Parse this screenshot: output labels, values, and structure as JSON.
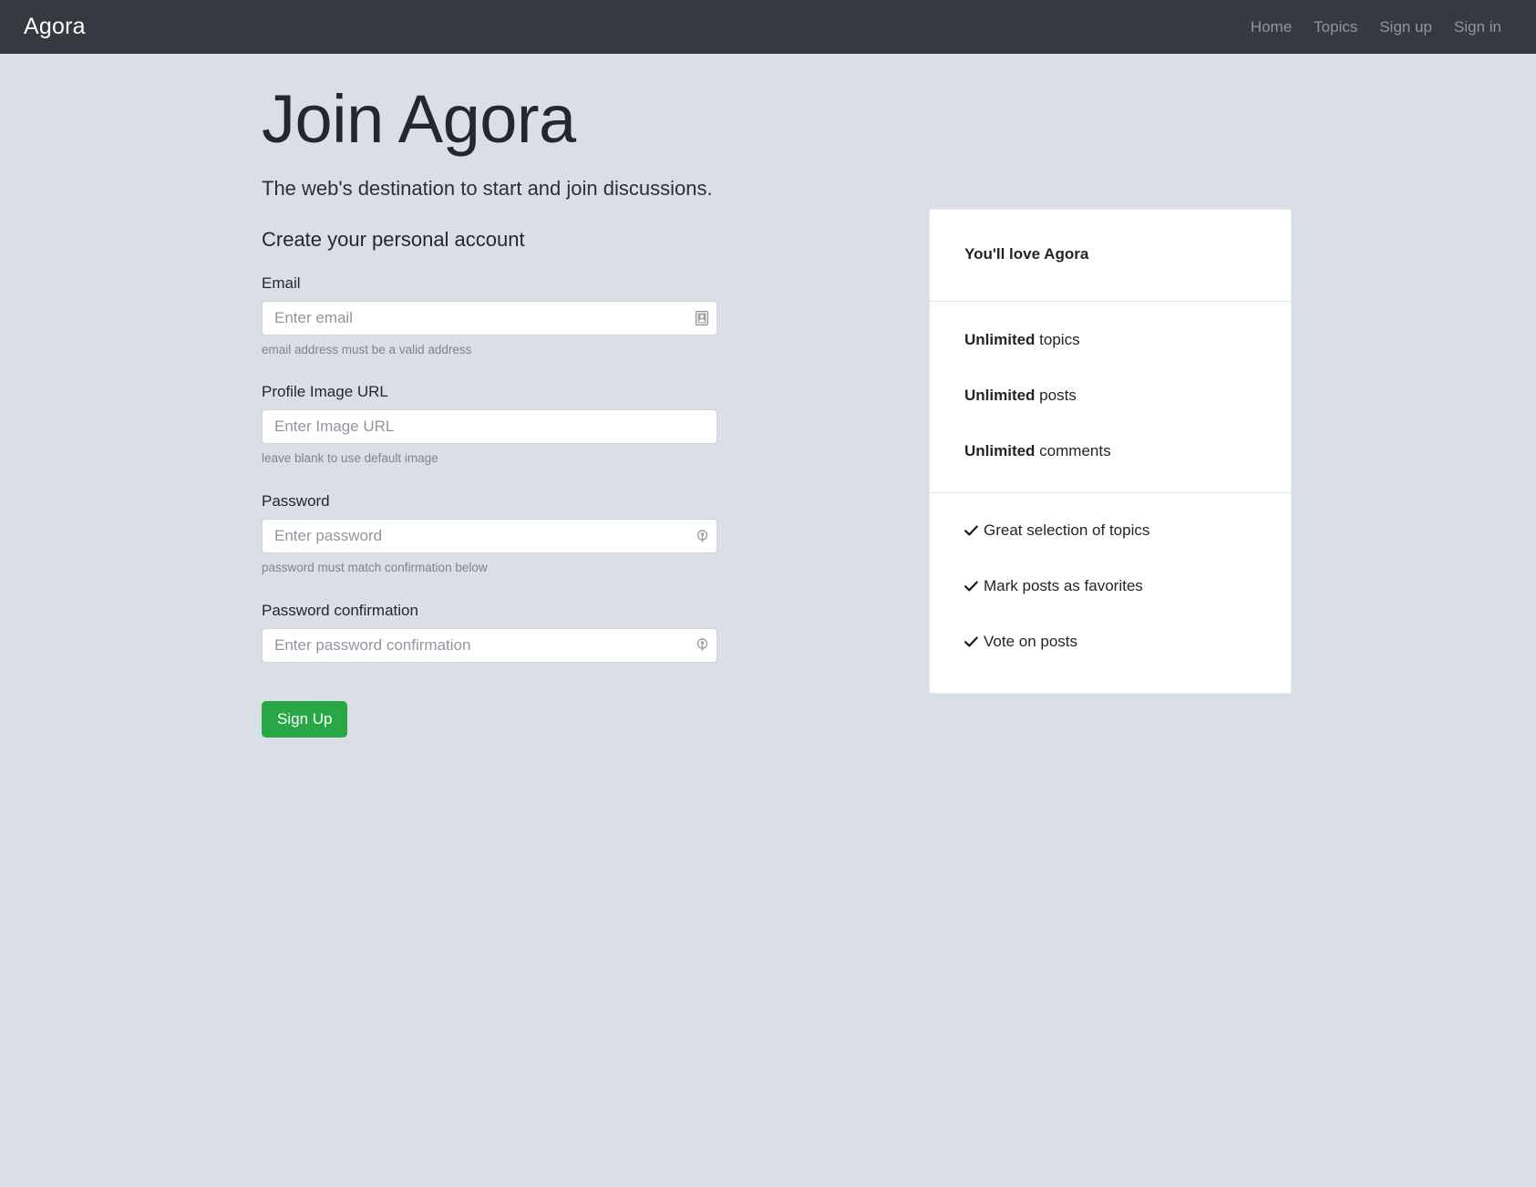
{
  "navbar": {
    "brand": "Agora",
    "links": [
      {
        "label": "Home"
      },
      {
        "label": "Topics"
      },
      {
        "label": "Sign up"
      },
      {
        "label": "Sign in"
      }
    ]
  },
  "hero": {
    "title": "Join Agora",
    "lead": "The web's destination to start and join discussions."
  },
  "form": {
    "title": "Create your personal account",
    "fields": [
      {
        "label": "Email",
        "placeholder": "Enter email",
        "value": "",
        "help": "email address must be a valid address",
        "icon": "contact-card-autofill-icon"
      },
      {
        "label": "Profile Image URL",
        "placeholder": "Enter Image URL",
        "value": "",
        "help": "leave blank to use default image",
        "icon": ""
      },
      {
        "label": "Password",
        "placeholder": "Enter password",
        "value": "",
        "help": "password must match confirmation below",
        "icon": "key-icon"
      },
      {
        "label": "Password confirmation",
        "placeholder": "Enter password confirmation",
        "value": "",
        "help": "",
        "icon": "key-icon"
      }
    ],
    "submit_label": "Sign Up",
    "submit_color": "#28a745"
  },
  "card": {
    "header": "You'll love Agora",
    "limits": [
      {
        "strong": "Unlimited",
        "rest": " topics"
      },
      {
        "strong": "Unlimited",
        "rest": " posts"
      },
      {
        "strong": "Unlimited",
        "rest": " comments"
      }
    ],
    "features": [
      {
        "icon": "check-icon",
        "label": "Great selection of topics"
      },
      {
        "icon": "check-icon",
        "label": "Mark posts as favorites"
      },
      {
        "icon": "check-icon",
        "label": "Vote on posts"
      }
    ]
  },
  "colors": {
    "navbar_bg": "#343a40",
    "page_bg": "#dadfe7",
    "accent_green": "#28a745",
    "card_bg": "#ffffff",
    "muted_text": "#7b8493"
  }
}
